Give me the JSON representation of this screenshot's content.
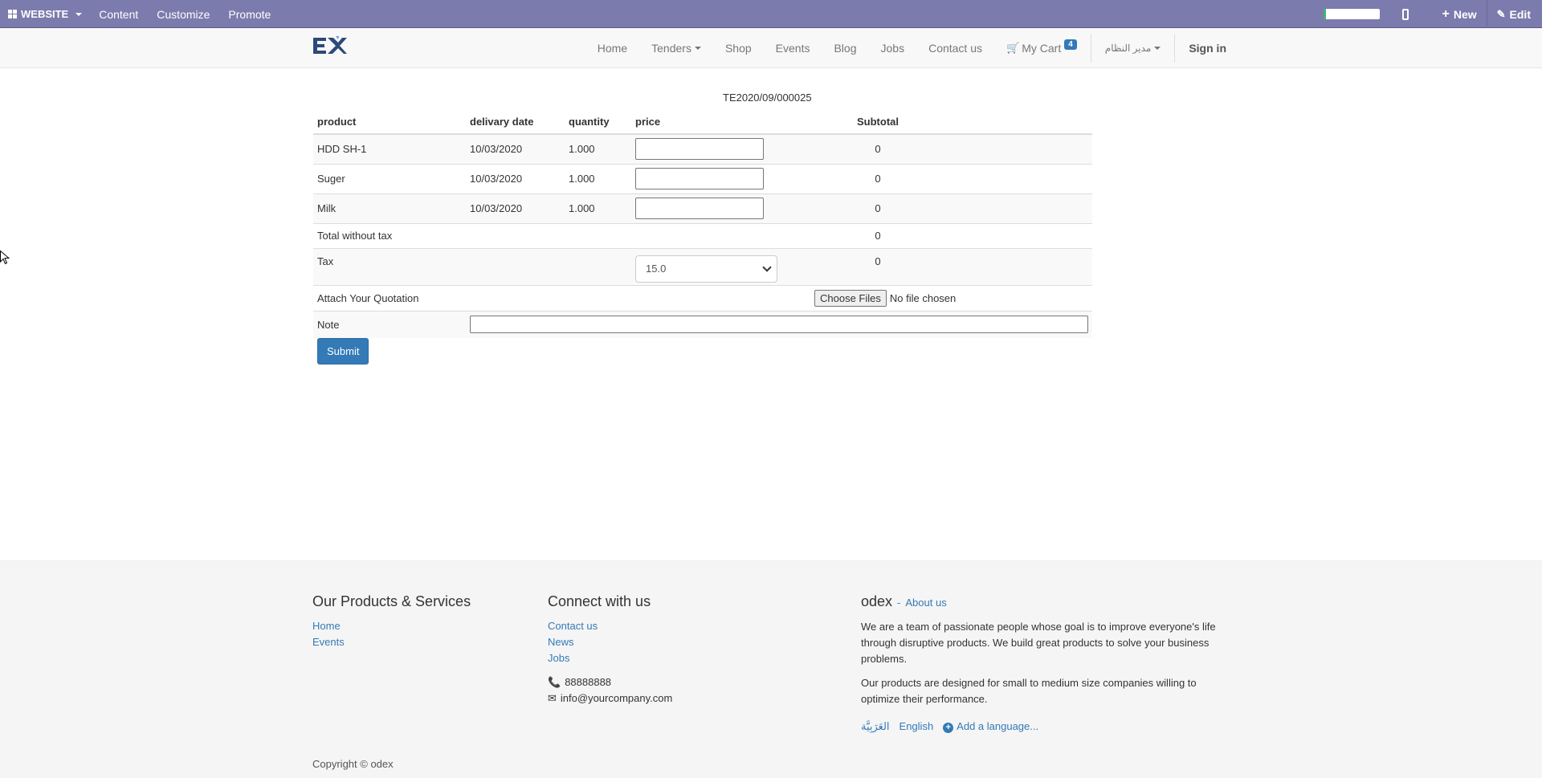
{
  "adminbar": {
    "brand": "WEBSITE",
    "menus": [
      "Content",
      "Customize",
      "Promote"
    ],
    "progress": 0.05,
    "new_label": "New",
    "edit_label": "Edit"
  },
  "navbar": {
    "items": [
      "Home",
      "Tenders",
      "Shop",
      "Events",
      "Blog",
      "Jobs",
      "Contact us"
    ],
    "cart_label": "My Cart",
    "cart_count": "4",
    "user_label": "مدير النظام",
    "signin_label": "Sign in"
  },
  "tender": {
    "reference": "TE2020/09/000025",
    "headers": {
      "product": "product",
      "delivery_date": "delivary date",
      "quantity": "quantity",
      "price": "price",
      "subtotal": "Subtotal"
    },
    "lines": [
      {
        "product": "HDD SH-1",
        "delivery_date": "10/03/2020",
        "quantity": "1.000",
        "price": "",
        "subtotal": "0"
      },
      {
        "product": "Suger",
        "delivery_date": "10/03/2020",
        "quantity": "1.000",
        "price": "",
        "subtotal": "0"
      },
      {
        "product": "Milk",
        "delivery_date": "10/03/2020",
        "quantity": "1.000",
        "price": "",
        "subtotal": "0"
      }
    ],
    "total_without_tax_label": "Total without tax",
    "total_without_tax": "0",
    "tax_label": "Tax",
    "tax_selected": "15.0",
    "tax_amount": "0",
    "attach_label": "Attach Your Quotation",
    "choose_files_label": "Choose Files",
    "no_file_label": "No file chosen",
    "note_label": "Note",
    "note_value": "",
    "submit_label": "Submit"
  },
  "footer": {
    "products_title": "Our Products & Services",
    "products_links": [
      "Home",
      "Events"
    ],
    "connect_title": "Connect with us",
    "connect_links": [
      "Contact us",
      "News",
      "Jobs"
    ],
    "phone": "88888888",
    "email": "info@yourcompany.com",
    "company_name": "odex",
    "about_link": "About us",
    "about_p1": "We are a team of passionate people whose goal is to improve everyone's life through disruptive products. We build great products to solve your business problems.",
    "about_p2": "Our products are designed for small to medium size companies willing to optimize their performance.",
    "languages": [
      "العَرَبِيَّة",
      "English"
    ],
    "add_language": "Add a language...",
    "copyright": "Copyright © odex"
  },
  "colors": {
    "adminbar": "#7c7bad",
    "primary": "#337ab7",
    "navbar": "#f8f8f8",
    "footer": "#f5f5f5"
  }
}
